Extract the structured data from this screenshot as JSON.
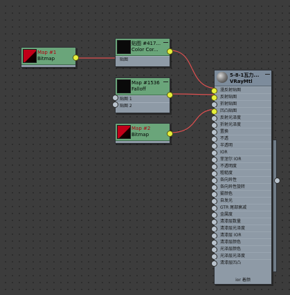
{
  "nodes": {
    "bitmap1": {
      "title_line1": "Map #1",
      "title_line2": "Bitmap"
    },
    "colorcorrect": {
      "title_line1": "贴图 #417...",
      "title_line2": "Color  Cor...",
      "input_label": "贴图"
    },
    "falloff": {
      "title_line1": "Map #1536",
      "title_line2": "Falloff",
      "inputs": [
        "贴图 1",
        "贴图 2"
      ]
    },
    "bitmap2": {
      "title_line1": "Map #2",
      "title_line2": "Bitmap"
    },
    "vraymtl": {
      "title_line1": "5-8-1瓦力...",
      "title_line2": "VRayMtl",
      "inputs": [
        "漫反射贴图",
        "反射贴图",
        "折射贴图",
        "凹凸贴图",
        "反射光泽度",
        "折射光泽度",
        "置换",
        "不透",
        "半透明",
        "IOR",
        "菲涅尔 IOR",
        "不透明度",
        "粗糙度",
        "各向异性",
        "各向异性旋转",
        "雾颜色",
        "自发光",
        "GTR 尾部衰减",
        "金属度",
        "清漆层数量",
        "清漆层光泽度",
        "清漆层 IOR",
        "清漆层颜色",
        "光泽层颜色",
        "光泽层光泽度",
        "清漆层凹凸"
      ],
      "footer": "ior 着颜"
    }
  },
  "colors": {
    "canvas": "#3c3c3c",
    "node_body": "#8e9aa6",
    "map_header": "#6aa57a",
    "material_header": "#7d8c9c",
    "wire": "#e05050",
    "port_active": "#e6f03c"
  }
}
